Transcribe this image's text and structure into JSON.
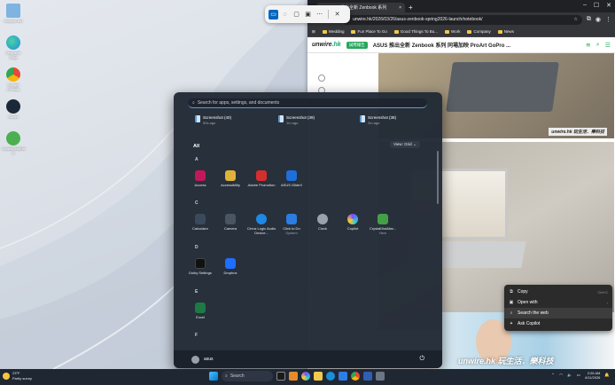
{
  "desktop": {
    "icons": [
      {
        "label": "Recycle Bin",
        "icon": "recycle-bin-icon",
        "color": "#7fb3e0"
      },
      {
        "label": "Microsoft Edge",
        "icon": "edge-icon",
        "color": "#1a8fd9"
      },
      {
        "label": "Google Chrome",
        "icon": "chrome-icon",
        "color": "#e9473b"
      },
      {
        "label": "Steam",
        "icon": "steam-icon",
        "color": "#1b2838"
      },
      {
        "label": "CrystalDiskInfo 9",
        "icon": "crystaldiskinfo-icon",
        "color": "#4caf50"
      }
    ]
  },
  "browser": {
    "tab_title": "ASUS 推出全新 Zenbook 系列",
    "url": "unwire.hk/2026/03/26/asus-zenbook-spring2026-launch/notebook/",
    "bookmarks": [
      "Wedding",
      "Fun Place To Go",
      "Good Things To Bu...",
      "Work",
      "Company",
      "News"
    ],
    "site": {
      "logo_text": "unwire",
      "logo_suffix": ".hk",
      "badge": "試用報告",
      "headline": "ASUS 推出全新 Zenbook 系列 同場加映 ProArt GoPro ...",
      "photo_watermark": "unwire.hk 玩生活．樂科技",
      "banner_watermark": "unwire.hk 玩生活．樂科技"
    }
  },
  "context_menu": {
    "items": [
      {
        "label": "Copy",
        "shortcut": "Ctrl+C",
        "icon": "copy-icon"
      },
      {
        "label": "Open with",
        "shortcut": "›",
        "icon": "open-with-icon"
      },
      {
        "label": "Search the web",
        "shortcut": "",
        "icon": "search-icon"
      },
      {
        "label": "Ask Copilot",
        "shortcut": "",
        "icon": "copilot-icon"
      }
    ]
  },
  "start_menu": {
    "search_placeholder": "Search for apps, settings, and documents",
    "recent": [
      {
        "name": "Screenshot (40)",
        "time": "50s ago"
      },
      {
        "name": "Screenshot (39)",
        "time": "1m ago"
      },
      {
        "name": "Screenshot (38)",
        "time": "2m ago"
      }
    ],
    "all_label": "All",
    "view_label": "View: Grid",
    "groups": [
      {
        "letter": "A",
        "apps": [
          {
            "name": "Access",
            "sub": "",
            "color": "#c2185b"
          },
          {
            "name": "Accessibility",
            "sub": "",
            "color": "#e0b23a"
          },
          {
            "name": "Adobe Promotion",
            "sub": "",
            "color": "#d32f2f"
          },
          {
            "name": "ASUS GlideX",
            "sub": "",
            "color": "#1e6fd9"
          }
        ]
      },
      {
        "letter": "C",
        "apps": [
          {
            "name": "Calculator",
            "sub": "",
            "color": "#3a4a5c"
          },
          {
            "name": "Camera",
            "sub": "",
            "color": "#4a5561"
          },
          {
            "name": "Cirrus Logic Audio Device...",
            "sub": "",
            "color": "#1e88e5"
          },
          {
            "name": "Click to Do",
            "sub": "System",
            "color": "#2a7de1"
          },
          {
            "name": "Clock",
            "sub": "",
            "color": "#9aa3ad"
          },
          {
            "name": "Copilot",
            "sub": "",
            "color": "#7c4dff"
          },
          {
            "name": "CrystalDiskMar...",
            "sub": "New",
            "color": "#43a047"
          }
        ]
      },
      {
        "letter": "D",
        "apps": [
          {
            "name": "Dolby Settings",
            "sub": "",
            "color": "#111111"
          },
          {
            "name": "Dropbox",
            "sub": "",
            "color": "#1e6fff"
          }
        ]
      },
      {
        "letter": "E",
        "apps": [
          {
            "name": "Excel",
            "sub": "",
            "color": "#1d7a45"
          }
        ]
      },
      {
        "letter": "F",
        "apps": []
      }
    ],
    "user_name": "asus"
  },
  "taskbar": {
    "weather_temp": "23°F",
    "weather_desc": "Partly sunny",
    "search_label": "Search",
    "time": "2:26 AM",
    "date": "4/11/2026"
  }
}
